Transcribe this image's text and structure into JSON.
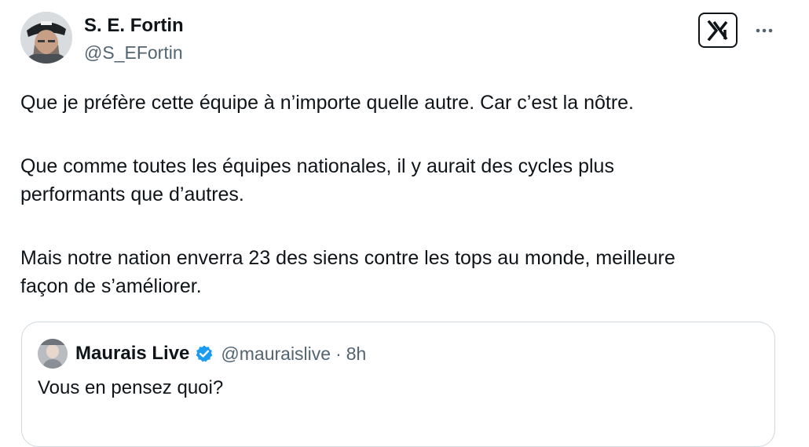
{
  "author": {
    "name": "S. E. Fortin",
    "handle": "@S_EFortin"
  },
  "header": {
    "platform_icon": "x-logo-icon",
    "more_icon": "more-horizontal-icon"
  },
  "tweet": {
    "paragraphs": [
      "Que je préfère cette équipe à n’importe quelle autre. Car c’est la nôtre.",
      "Que comme toutes les équipes nationales, il y aurait des cycles plus",
      "performants que d’autres.",
      "Mais notre nation enverra 23 des siens contre les tops au monde, meilleure",
      "façon de s’améliorer."
    ]
  },
  "quote": {
    "name": "Maurais Live",
    "verified": true,
    "handle": "@mauraislive",
    "separator": "·",
    "time": "8h",
    "text": "Vous en pensez quoi?"
  },
  "colors": {
    "text": "#0f1419",
    "secondary": "#536471",
    "verified": "#1d9bf0",
    "border": "#cfd9de"
  }
}
